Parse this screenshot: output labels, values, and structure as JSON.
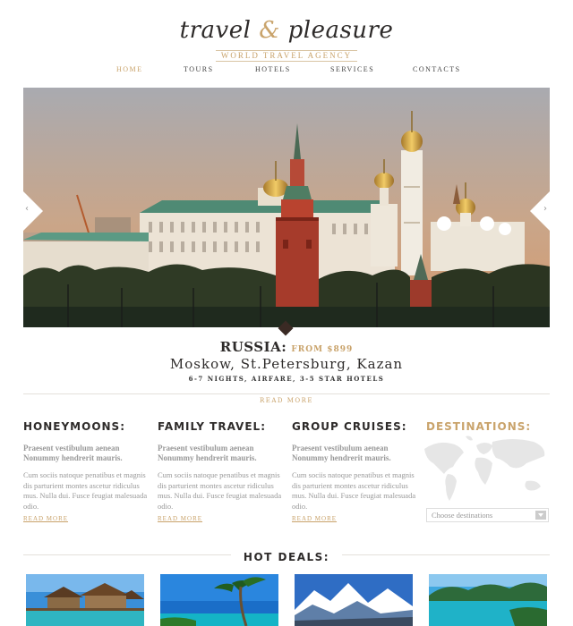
{
  "brand": {
    "name_part1": "travel",
    "ampersand": "&",
    "name_part2": "pleasure",
    "tagline": "WORLD TRAVEL AGENCY"
  },
  "nav": [
    {
      "label": "HOME",
      "active": true
    },
    {
      "label": "TOURS",
      "active": false
    },
    {
      "label": "HOTELS",
      "active": false
    },
    {
      "label": "SERVICES",
      "active": false
    },
    {
      "label": "CONTACTS",
      "active": false
    }
  ],
  "slider": {
    "prev_arrow": "‹",
    "next_arrow": "›"
  },
  "tour": {
    "country": "RUSSIA:",
    "from": "FROM $899",
    "cities": "Moskow, St.Petersburg, Kazan",
    "details": "6-7 NIGHTS, AIRFARE, 3-5 STAR HOTELS",
    "read_more": "READ MORE"
  },
  "columns": [
    {
      "title": "HONEYMOONS:",
      "lead": "Praesent vestibulum aenean Nonummy hendrerit mauris.",
      "body": "Cum sociis natoque penatibus et magnis dis parturient montes ascetur ridiculus mus. Nulla dui. Fusce feugiat malesuada odio.",
      "more": "READ MORE"
    },
    {
      "title": "FAMILY TRAVEL:",
      "lead": "Praesent vestibulum aenean Nonummy hendrerit mauris.",
      "body": "Cum sociis natoque penatibus et magnis dis parturient montes ascetur ridiculus mus. Nulla dui. Fusce feugiat malesuada odio.",
      "more": "READ MORE"
    },
    {
      "title": "GROUP CRUISES:",
      "lead": "Praesent vestibulum aenean Nonummy hendrerit mauris.",
      "body": "Cum sociis natoque penatibus et magnis dis parturient montes ascetur ridiculus mus. Nulla dui. Fusce feugiat malesuada odio.",
      "more": "READ MORE"
    }
  ],
  "destinations": {
    "title": "DESTINATIONS:",
    "placeholder": "Choose destinations"
  },
  "deals": {
    "title": "HOT DEALS:"
  },
  "colors": {
    "accent": "#c9a36b",
    "heading": "#2e2b2a",
    "muted": "#999999"
  }
}
